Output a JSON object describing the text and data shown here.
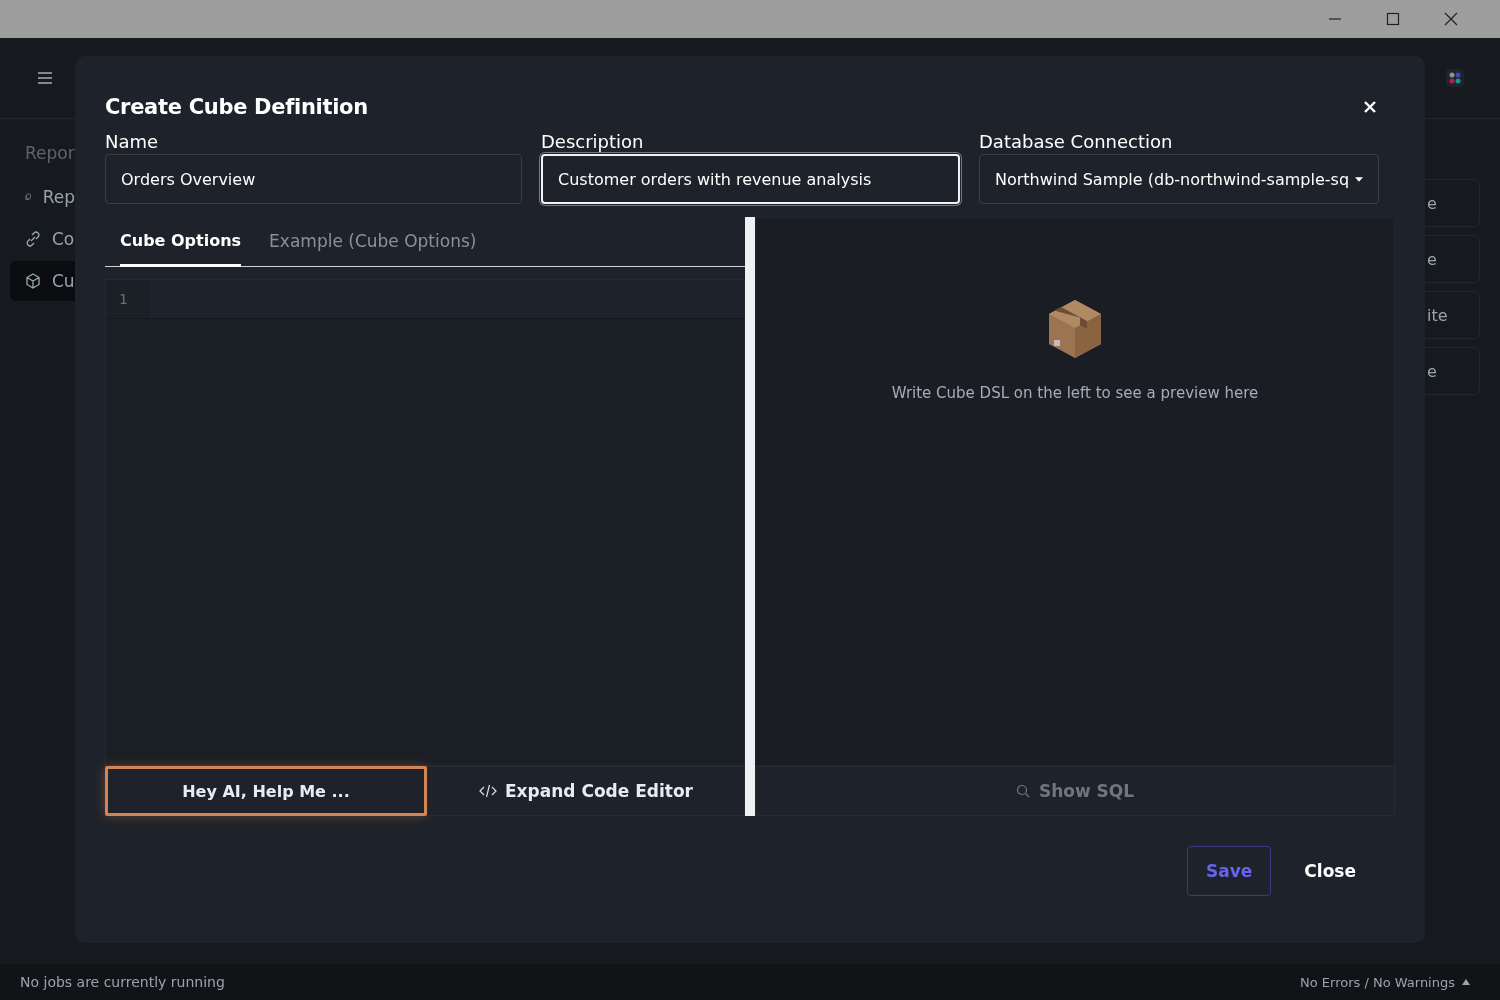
{
  "sidebar": {
    "heading": "Repor",
    "items": [
      {
        "kind": "document",
        "label": "Rep",
        "selected": false
      },
      {
        "kind": "link",
        "label": "Co",
        "selected": false
      },
      {
        "kind": "cube",
        "label": "Cu",
        "selected": true
      }
    ]
  },
  "right_cards": [
    {
      "label": "e"
    },
    {
      "label": "e"
    },
    {
      "label": "ite"
    },
    {
      "label": "e"
    }
  ],
  "dialog": {
    "title": "Create Cube Definition",
    "fields": [
      {
        "kind": "text",
        "label": "Name",
        "value": "Orders Overview",
        "focused": false
      },
      {
        "kind": "text",
        "label": "Description",
        "value": "Customer orders with revenue analysis",
        "focused": true
      },
      {
        "kind": "select",
        "label": "Database Connection",
        "value": "Northwind Sample (db-northwind-sample-sq",
        "focused": false
      }
    ],
    "editor": {
      "tabs": [
        {
          "label": "Cube Options",
          "selected": true
        },
        {
          "label": "Example (Cube Options)",
          "selected": false
        }
      ],
      "line_numbers": [
        "1"
      ],
      "buttons": [
        {
          "kind": "ai",
          "label": "Hey AI, Help Me ...",
          "highlighted": true
        },
        {
          "kind": "code",
          "label": "Expand Code Editor",
          "highlighted": false
        }
      ]
    },
    "preview": {
      "message": "Write Cube DSL on the left to see a preview here",
      "show_sql": {
        "label": "Show SQL",
        "disabled": true
      }
    },
    "actions": [
      {
        "kind": "primary",
        "label": "Save"
      },
      {
        "kind": "plain",
        "label": "Close"
      }
    ]
  },
  "status_bar": {
    "left": "No jobs are currently running",
    "right": "No Errors / No Warnings"
  }
}
